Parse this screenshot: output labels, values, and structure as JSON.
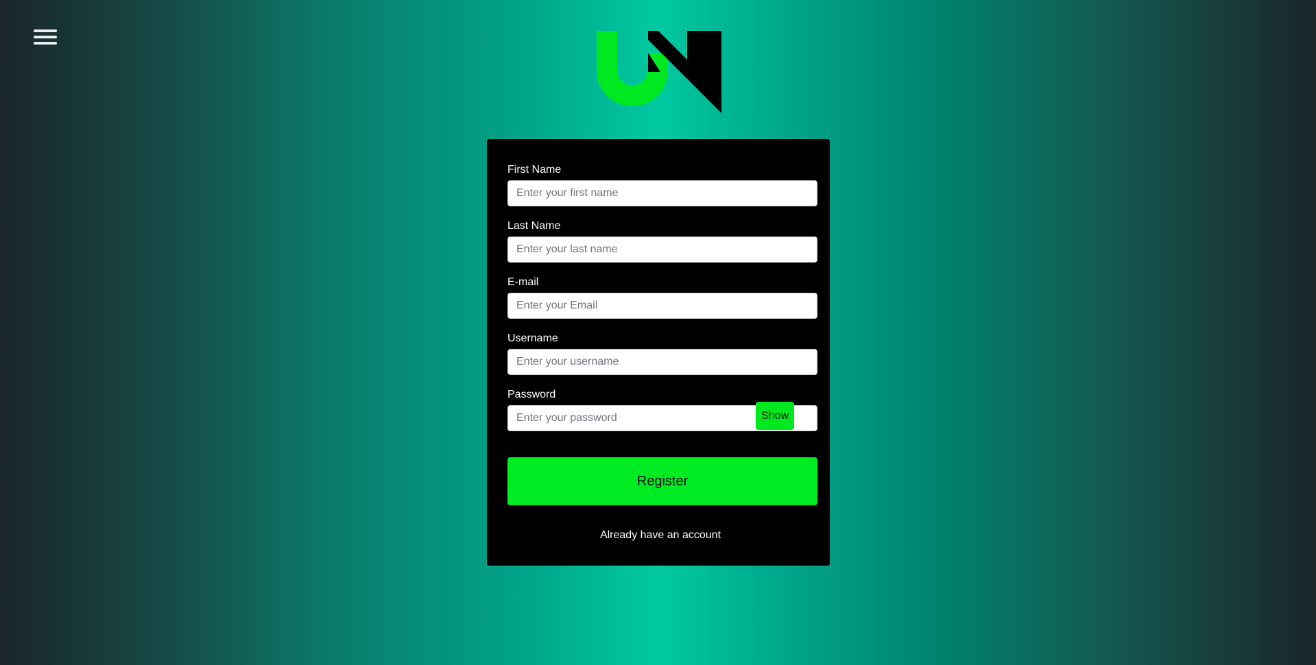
{
  "header": {
    "menu_icon": "hamburger-menu-icon",
    "logo": {
      "icon": "un-logo",
      "colors": {
        "u": "#00e820",
        "n": "#000000"
      }
    }
  },
  "form": {
    "first_name": {
      "label": "First Name",
      "placeholder": "Enter your first name"
    },
    "last_name": {
      "label": "Last Name",
      "placeholder": "Enter your last name"
    },
    "email": {
      "label": "E-mail",
      "placeholder": "Enter your Email"
    },
    "username": {
      "label": "Username",
      "placeholder": "Enter your username"
    },
    "password": {
      "label": "Password",
      "placeholder": "Enter your password",
      "show_label": "Show"
    },
    "register_label": "Register",
    "login_link": "Already have an account"
  },
  "colors": {
    "accent": "#00e820",
    "card_background": "#000000",
    "background_center": "#00c9a0",
    "background_edge": "#1a2528"
  }
}
